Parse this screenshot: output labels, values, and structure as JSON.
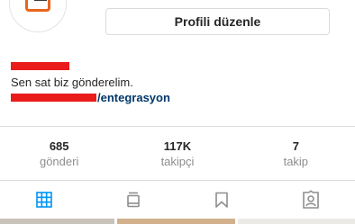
{
  "profile": {
    "edit_button": "Profili düzenle",
    "bio": "Sen sat biz gönderelim.",
    "link_suffix": "/entegrasyon"
  },
  "stats": [
    {
      "value": "685",
      "label": "gönderi"
    },
    {
      "value": "117K",
      "label": "takipçi"
    },
    {
      "value": "7",
      "label": "takip"
    }
  ],
  "tabs": [
    {
      "icon": "grid-icon",
      "active": true
    },
    {
      "icon": "igtv-icon",
      "active": false
    },
    {
      "icon": "bookmark-icon",
      "active": false
    },
    {
      "icon": "tagged-icon",
      "active": false
    }
  ],
  "colors": {
    "accent": "#0095f6",
    "redaction": "#ea1b1b",
    "link": "#00376b",
    "logo": "#e8651f"
  }
}
